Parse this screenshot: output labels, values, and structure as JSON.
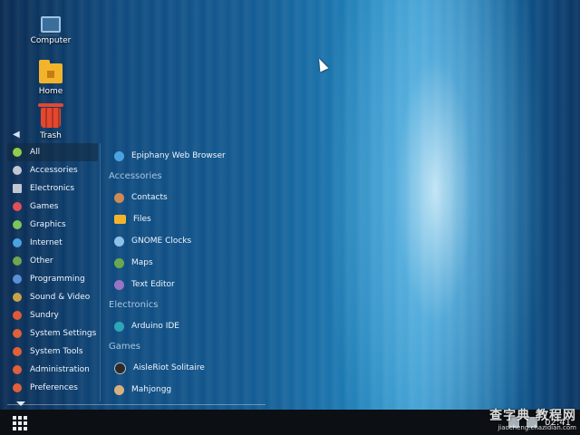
{
  "desktop": {
    "icons": [
      {
        "label": "Computer",
        "icon": "computer-icon"
      },
      {
        "label": "Home",
        "icon": "home-folder-icon"
      },
      {
        "label": "Trash",
        "icon": "trash-icon"
      }
    ]
  },
  "menu": {
    "categories": [
      {
        "label": "All",
        "icon": "all-icon",
        "color": "#8fce4a",
        "active": true
      },
      {
        "label": "Accessories",
        "icon": "accessories-icon",
        "color": "#c0c8d2"
      },
      {
        "label": "Electronics",
        "icon": "electronics-icon",
        "color": "#c0c8d2"
      },
      {
        "label": "Games",
        "icon": "games-icon",
        "color": "#e0505a"
      },
      {
        "label": "Graphics",
        "icon": "graphics-icon",
        "color": "#7ec65a"
      },
      {
        "label": "Internet",
        "icon": "internet-icon",
        "color": "#4aa3e0"
      },
      {
        "label": "Other",
        "icon": "other-icon",
        "color": "#6fa650"
      },
      {
        "label": "Programming",
        "icon": "programming-icon",
        "color": "#5a90d8"
      },
      {
        "label": "Sound & Video",
        "icon": "sound-video-icon",
        "color": "#c9a24a"
      },
      {
        "label": "Sundry",
        "icon": "sundry-icon",
        "color": "#e05a3a"
      },
      {
        "label": "System Settings",
        "icon": "system-settings-icon",
        "color": "#e0603a"
      },
      {
        "label": "System Tools",
        "icon": "system-tools-icon",
        "color": "#e0603a"
      },
      {
        "label": "Administration",
        "icon": "administration-icon",
        "color": "#e0603a"
      },
      {
        "label": "Preferences",
        "icon": "preferences-icon",
        "color": "#e0603a"
      }
    ],
    "top_apps": [
      {
        "label": "Epiphany Web Browser",
        "icon": "epiphany-icon",
        "color": "#4aa3e0"
      }
    ],
    "sections": [
      {
        "title": "Accessories",
        "apps": [
          {
            "label": "Contacts",
            "icon": "contacts-icon",
            "color": "#d08a52"
          },
          {
            "label": "Files",
            "icon": "files-folder-icon",
            "color": "#f3b42c",
            "folder": true
          },
          {
            "label": "GNOME Clocks",
            "icon": "clocks-icon",
            "color": "#8cc2e8"
          },
          {
            "label": "Maps",
            "icon": "maps-icon",
            "color": "#6aa84f"
          },
          {
            "label": "Text Editor",
            "icon": "text-editor-icon",
            "color": "#9a74c4"
          }
        ]
      },
      {
        "title": "Electronics",
        "apps": [
          {
            "label": "Arduino IDE",
            "icon": "arduino-icon",
            "color": "#2fa5b8"
          }
        ]
      },
      {
        "title": "Games",
        "apps": [
          {
            "label": "AisleRiot Solitaire",
            "icon": "solitaire-icon",
            "color": "#2b2b2b"
          },
          {
            "label": "Mahjongg",
            "icon": "mahjongg-icon",
            "color": "#d8b080"
          }
        ]
      }
    ]
  },
  "taskbar": {
    "clock": "02:41"
  },
  "watermark": {
    "big": "查字典 教程网",
    "small": "jiaocheng.chazidian.com"
  }
}
